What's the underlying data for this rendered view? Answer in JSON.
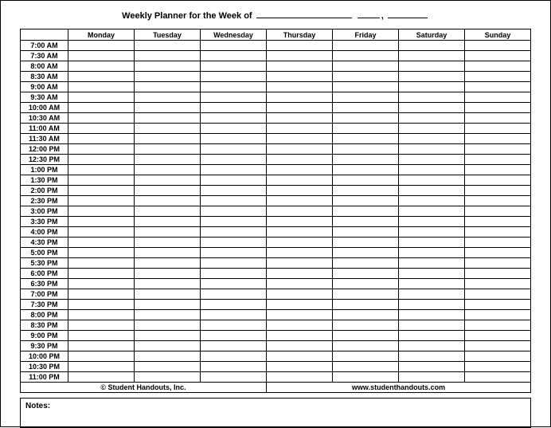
{
  "title_prefix": "Weekly Planner for the Week of",
  "comma": ",",
  "days": [
    "Monday",
    "Tuesday",
    "Wednesday",
    "Thursday",
    "Friday",
    "Saturday",
    "Sunday"
  ],
  "times": [
    "7:00 AM",
    "7:30 AM",
    "8:00 AM",
    "8:30 AM",
    "9:00 AM",
    "9:30 AM",
    "10:00 AM",
    "10:30 AM",
    "11:00 AM",
    "11:30 AM",
    "12:00 PM",
    "12:30 PM",
    "1:00 PM",
    "1:30 PM",
    "2:00 PM",
    "2:30 PM",
    "3:00 PM",
    "3:30 PM",
    "4:00 PM",
    "4:30 PM",
    "5:00 PM",
    "5:30 PM",
    "6:00 PM",
    "6:30 PM",
    "7:00 PM",
    "7:30 PM",
    "8:00 PM",
    "8:30 PM",
    "9:00 PM",
    "9:30 PM",
    "10:00 PM",
    "10:30 PM",
    "11:00 PM"
  ],
  "footer": {
    "copyright": "© Student Handouts, Inc.",
    "url": "www.studenthandouts.com"
  },
  "notes_label": "Notes:"
}
